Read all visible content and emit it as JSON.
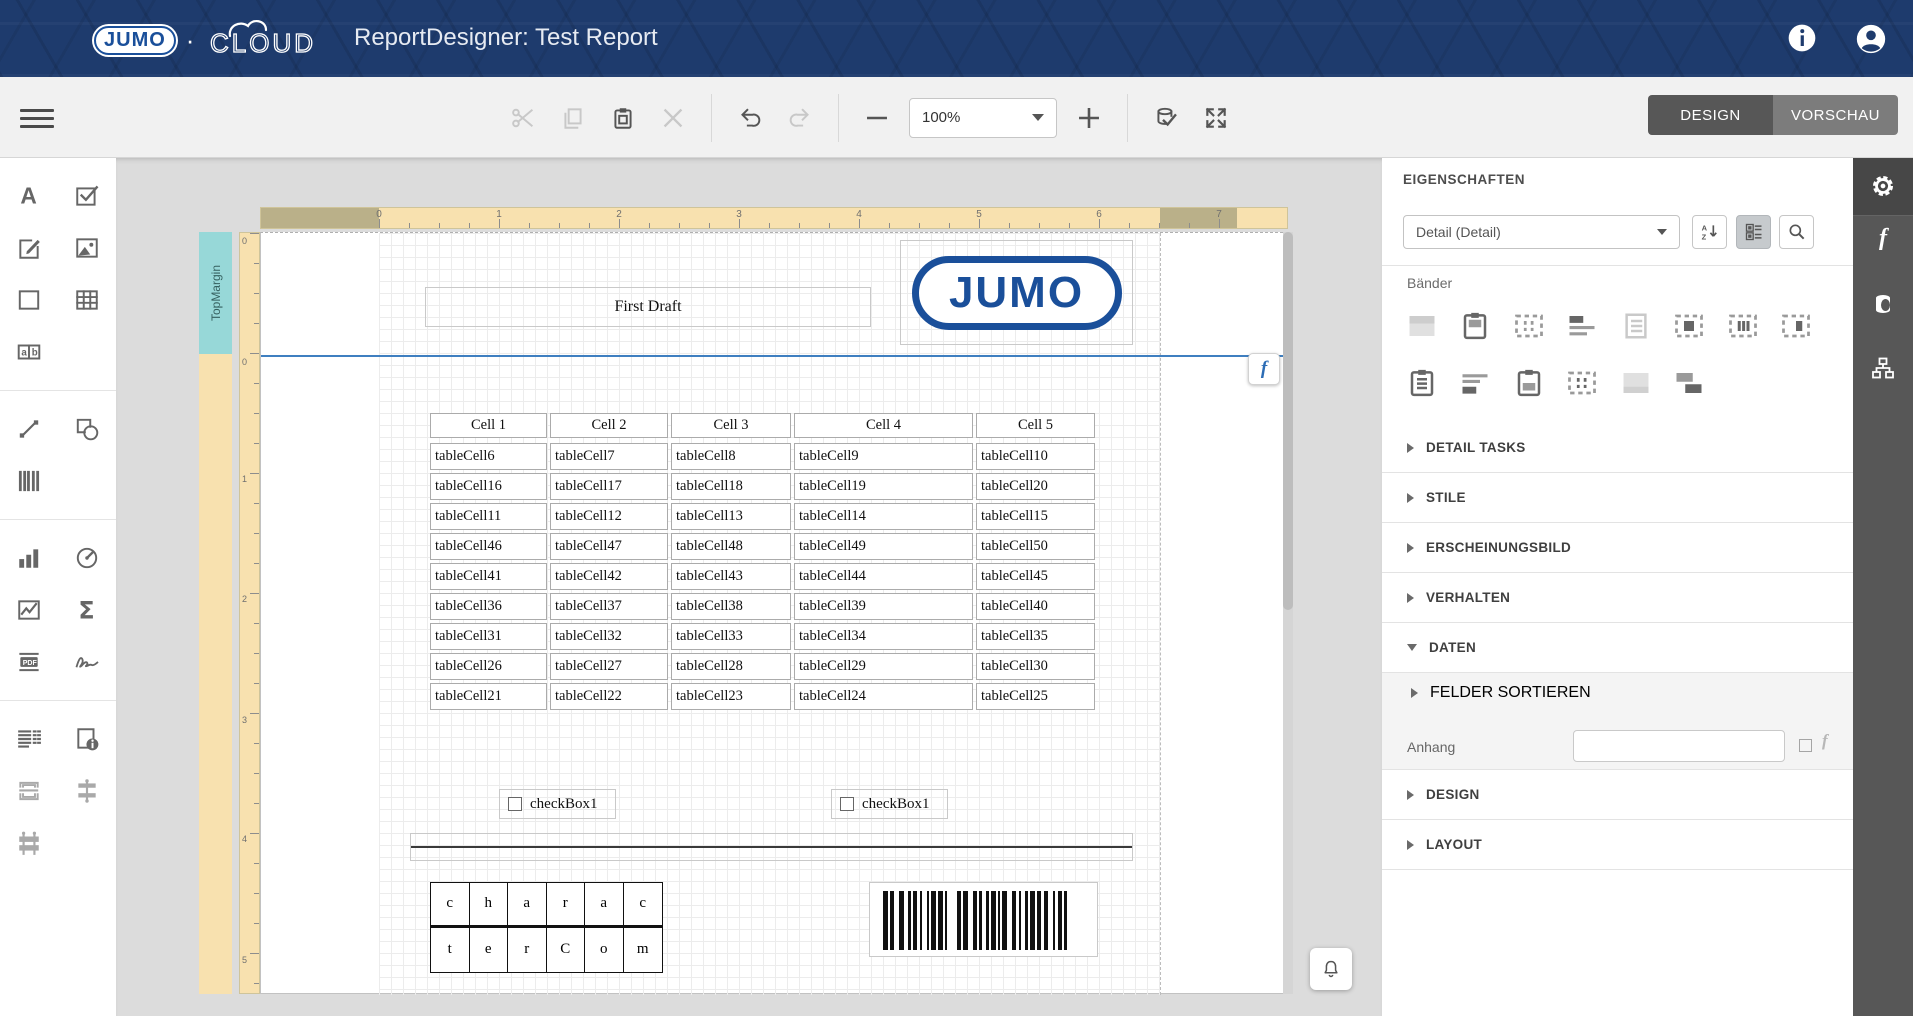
{
  "header": {
    "logo_text": "JUMO",
    "cloud_text": "CLOUD",
    "title": "ReportDesigner: Test Report",
    "icons": [
      "info-icon",
      "account-icon"
    ]
  },
  "toolbar": {
    "zoom_value": "100%",
    "groups": [
      [
        {
          "name": "cut",
          "disabled": true
        },
        {
          "name": "copy",
          "disabled": true
        },
        {
          "name": "paste",
          "disabled": false
        },
        {
          "name": "delete",
          "disabled": true
        }
      ],
      [
        {
          "name": "undo",
          "disabled": false
        },
        {
          "name": "redo",
          "disabled": true
        }
      ]
    ],
    "validate_group": [
      {
        "name": "validate",
        "disabled": false
      },
      {
        "name": "fullscreen",
        "disabled": false
      }
    ],
    "design_label": "DESIGN",
    "vorschau_label": "VORSCHAU"
  },
  "toolbox": {
    "rows": [
      {
        "type": "row",
        "icons": [
          "label",
          "checkbox"
        ]
      },
      {
        "type": "row",
        "icons": [
          "richtext",
          "picture"
        ]
      },
      {
        "type": "row",
        "icons": [
          "panel",
          "table"
        ]
      },
      {
        "type": "row",
        "icons": [
          "charactercomb"
        ]
      },
      {
        "type": "divider"
      },
      {
        "type": "row",
        "icons": [
          "line",
          "shape"
        ]
      },
      {
        "type": "row",
        "icons": [
          "barcode"
        ]
      },
      {
        "type": "divider"
      },
      {
        "type": "row",
        "icons": [
          "chart",
          "gauge"
        ]
      },
      {
        "type": "row",
        "icons": [
          "sparkline",
          "summary"
        ]
      },
      {
        "type": "row",
        "icons": [
          "pdfcontent",
          "signature"
        ]
      },
      {
        "type": "divider"
      },
      {
        "type": "row",
        "icons": [
          "toc",
          "pageinfo"
        ]
      },
      {
        "type": "row",
        "icons": [
          "pagebreak",
          "crossbandline"
        ],
        "disabled": true
      },
      {
        "type": "row",
        "icons": [
          "crossbandbox"
        ],
        "disabled": true
      }
    ]
  },
  "canvas": {
    "ruler_h_numbers": [
      "0",
      "1",
      "2",
      "3",
      "4",
      "5",
      "6",
      "7"
    ],
    "ruler_v_numbers": [
      "0",
      "0",
      "1",
      "2",
      "3",
      "4",
      "5"
    ],
    "top_margin_label": "TopMargin",
    "first_draft_text": "First Draft",
    "logo_text": "JUMO",
    "table": {
      "headers": [
        "Cell 1",
        "Cell 2",
        "Cell 3",
        "Cell 4",
        "Cell 5"
      ],
      "rows": [
        [
          "tableCell6",
          "tableCell7",
          "tableCell8",
          "tableCell9",
          "tableCell10"
        ],
        [
          "tableCell16",
          "tableCell17",
          "tableCell18",
          "tableCell19",
          "tableCell20"
        ],
        [
          "tableCell11",
          "tableCell12",
          "tableCell13",
          "tableCell14",
          "tableCell15"
        ],
        [
          "tableCell46",
          "tableCell47",
          "tableCell48",
          "tableCell49",
          "tableCell50"
        ],
        [
          "tableCell41",
          "tableCell42",
          "tableCell43",
          "tableCell44",
          "tableCell45"
        ],
        [
          "tableCell36",
          "tableCell37",
          "tableCell38",
          "tableCell39",
          "tableCell40"
        ],
        [
          "tableCell31",
          "tableCell32",
          "tableCell33",
          "tableCell34",
          "tableCell35"
        ],
        [
          "tableCell26",
          "tableCell27",
          "tableCell28",
          "tableCell29",
          "tableCell30"
        ],
        [
          "tableCell21",
          "tableCell22",
          "tableCell23",
          "tableCell24",
          "tableCell25"
        ]
      ]
    },
    "checkbox1_label": "checkBox1",
    "checkbox2_label": "checkBox1",
    "comb_row1": [
      "c",
      "h",
      "a",
      "r",
      "a",
      "c"
    ],
    "comb_row2": [
      "t",
      "e",
      "r",
      "C",
      "o",
      "m"
    ],
    "barcode_pattern": "11011001100101101001011011010000110110011010010110101100110100101101101100101101"
  },
  "properties": {
    "title": "EIGENSCHAFTEN",
    "selector_value": "Detail (Detail)",
    "tool_icons": [
      "sort-az-icon",
      "category-view-icon",
      "search-icon"
    ],
    "baender_label": "Bänder",
    "band_icons_row1": [
      "topmargin-band",
      "pageheader-band",
      "columnheader-band",
      "groupheader-band",
      "detail-band",
      "detailreport-band",
      "verticalheader-band",
      "verticaldetail-band"
    ],
    "band_icons_row2": [
      "pagefooter-band",
      "groupfooter-band",
      "reportfooter-band",
      "verticaltotal-band",
      "bottommargin-band",
      "subband"
    ],
    "sections": [
      {
        "label": "DETAIL TASKS",
        "expanded": false
      },
      {
        "label": "STILE",
        "expanded": false
      },
      {
        "label": "ERSCHEINUNGSBILD",
        "expanded": false
      },
      {
        "label": "VERHALTEN",
        "expanded": false
      },
      {
        "label": "DATEN",
        "expanded": true
      }
    ],
    "felder_label": "FELDER SORTIEREN",
    "anhang_label": "Anhang",
    "anhang_value": "",
    "design_label": "DESIGN",
    "layout_label": "LAYOUT"
  },
  "rightbar": {
    "icons": [
      "gear-icon",
      "function-icon",
      "database-icon",
      "hierarchy-icon"
    ]
  },
  "colors": {
    "header_navy": "#1e3b6d",
    "logo_blue": "#1a4f9a",
    "ruler_wheat": "#f8e1af",
    "ruler_dark": "#bab089",
    "topmargin_teal": "#97d8d8",
    "band_separator_blue": "#3f7fc0",
    "design_btn": "#575757",
    "vorschau_btn": "#7c7c7c"
  }
}
